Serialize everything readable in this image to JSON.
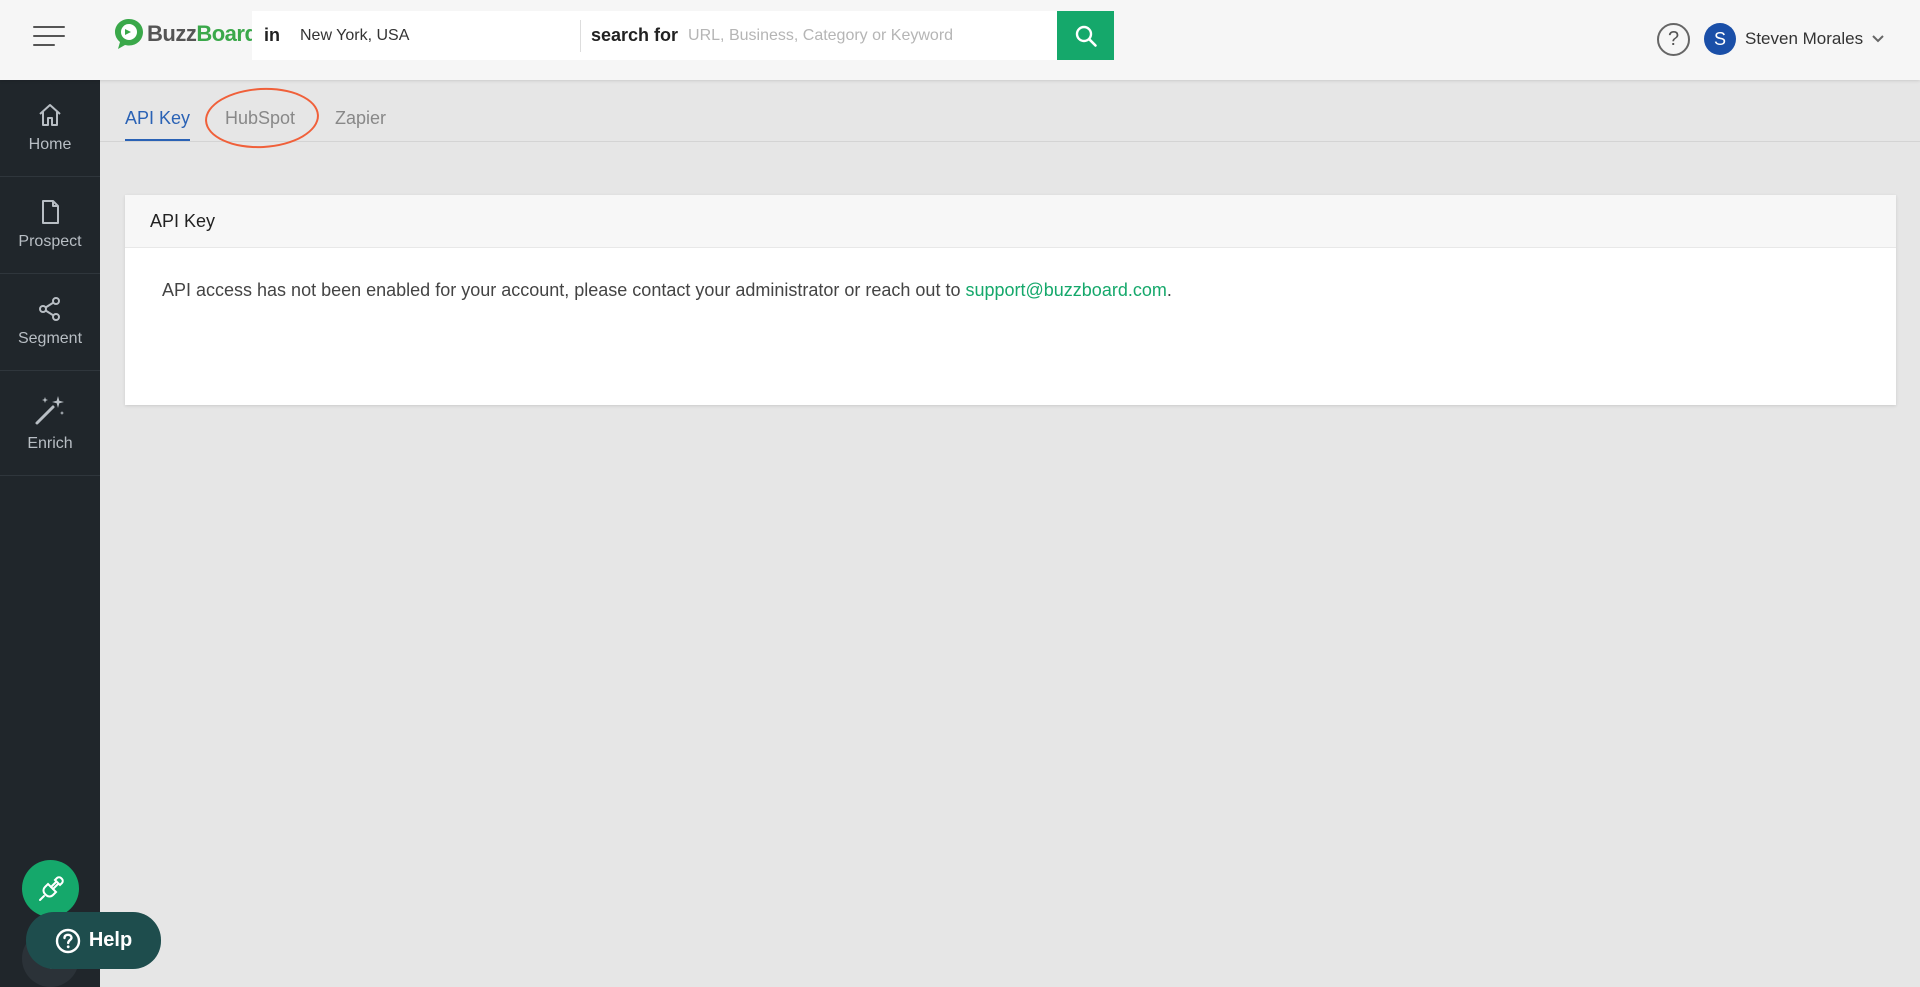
{
  "header": {
    "logo_buzz": "Buzz",
    "logo_board": "Board",
    "in_label": "in",
    "location_value": "New York, USA",
    "search_for_label": "search for",
    "keyword_placeholder": "URL, Business, Category or Keyword",
    "help_glyph": "?",
    "user_initial": "S",
    "user_name": "Steven Morales"
  },
  "sidebar": {
    "items": [
      {
        "label": "Home",
        "icon": "home-icon"
      },
      {
        "label": "Prospect",
        "icon": "document-icon"
      },
      {
        "label": "Segment",
        "icon": "segment-icon"
      },
      {
        "label": "Enrich",
        "icon": "magic-wand-icon"
      }
    ],
    "help_button_label": "Help"
  },
  "tabs": [
    {
      "label": "API Key",
      "active": true
    },
    {
      "label": "HubSpot",
      "active": false
    },
    {
      "label": "Zapier",
      "active": false
    }
  ],
  "card": {
    "title": "API Key",
    "message_prefix": "API access has not been enabled for your account, please contact your administrator or reach out to ",
    "email": "support@buzzboard.com",
    "message_suffix": "."
  },
  "colors": {
    "brand_green": "#15a86b",
    "sidebar_bg": "#20262b",
    "active_tab": "#2a62b5",
    "annotation": "#f0603a"
  }
}
